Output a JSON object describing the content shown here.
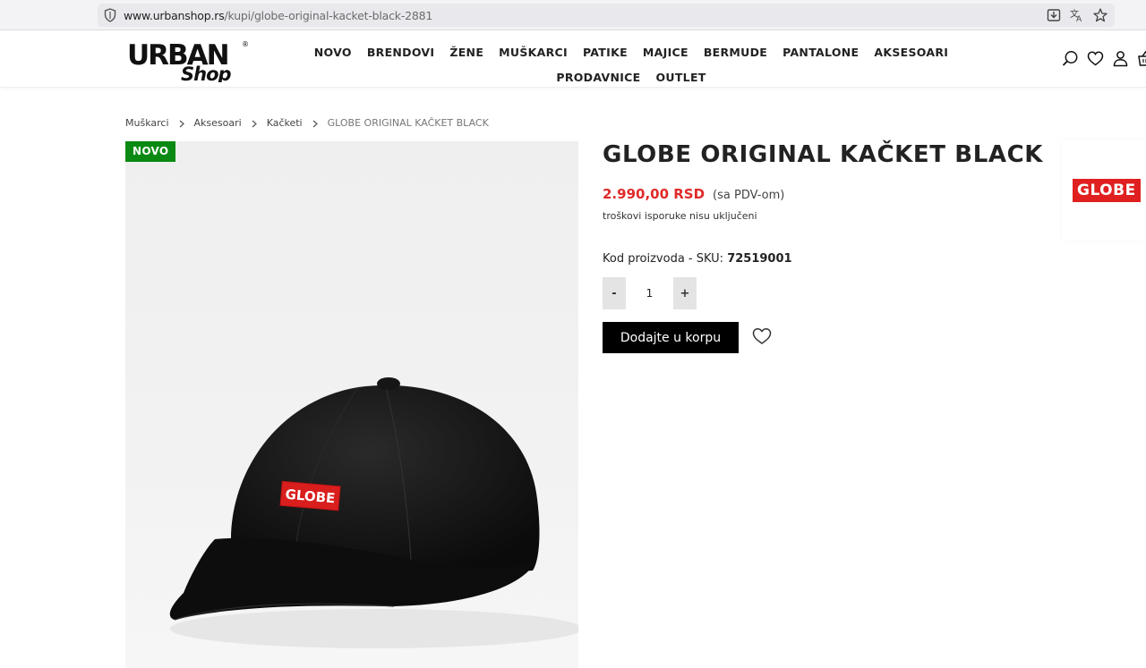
{
  "browser": {
    "url_host": "www.urbanshop.rs",
    "url_path": "/kupi/globe-original-kacket-black-2881"
  },
  "logo": {
    "line1": "URBAN",
    "line2": "Shop",
    "reg": "®"
  },
  "nav": {
    "row1": [
      "NOVO",
      "BRENDOVI",
      "ŽENE",
      "MUŠKARCI",
      "PATIKE",
      "MAJICE",
      "BERMUDE",
      "PANTALONE",
      "AKSESOARI"
    ],
    "row2": [
      "PRODAVNICE",
      "OUTLET"
    ]
  },
  "header_icons": [
    "search-icon",
    "heart-icon",
    "user-icon",
    "cart-icon"
  ],
  "breadcrumb": [
    "Muškarci",
    "Aksesoari",
    "Kačketi",
    "GLOBE ORIGINAL KAČKET BLACK"
  ],
  "badge": "NOVO",
  "product": {
    "title": "GLOBE ORIGINAL KAČKET BLACK",
    "price": "2.990,00 RSD",
    "vat_note": "(sa PDV-om)",
    "shipping_note": "troškovi isporuke nisu uključeni",
    "sku_label": "Kod proizvoda - SKU:",
    "sku_value": "72519001",
    "quantity": "1",
    "qty_minus": "-",
    "qty_plus": "+",
    "add_to_cart": "Dodajte u korpu",
    "cap_label": "GLOBE"
  },
  "brand": {
    "name": "GLOBE"
  },
  "colors": {
    "accent_price": "#e02a2a",
    "badge_green": "#0a8a12",
    "brand_red": "#e02020",
    "button_black": "#000000"
  }
}
